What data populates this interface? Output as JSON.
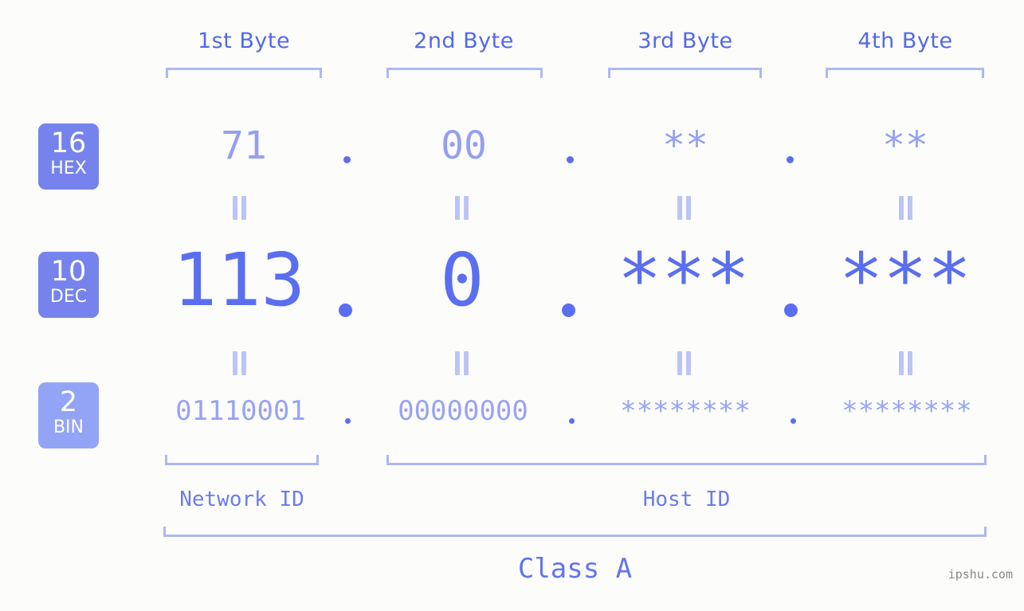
{
  "background_color": "#fcfdfa",
  "accent_color": "#5a6ef0",
  "accent_light_color": "#aeb7f2",
  "bytes": {
    "headers": [
      {
        "label": "1st Byte"
      },
      {
        "label": "2nd Byte"
      },
      {
        "label": "3rd Byte"
      },
      {
        "label": "4th Byte"
      }
    ]
  },
  "bases": [
    {
      "number": "16",
      "name": "HEX",
      "color": "#7683ec"
    },
    {
      "number": "10",
      "name": "DEC",
      "color": "#7683ec"
    },
    {
      "number": "2",
      "name": "BIN",
      "color": "#93a4f7"
    }
  ],
  "rows": {
    "hex": {
      "values": [
        "71",
        "00",
        "**",
        "**"
      ]
    },
    "dec": {
      "values": [
        "113",
        "0",
        "***",
        "***"
      ]
    },
    "bin": {
      "values": [
        "01110001",
        "00000000",
        "********",
        "********"
      ]
    }
  },
  "separators": {
    "glyph": ".",
    "equals_glyph": "="
  },
  "segments": [
    {
      "label": "Network ID"
    },
    {
      "label": "Host ID"
    }
  ],
  "class": {
    "label": "Class A"
  },
  "watermark": {
    "text": "ipshu.com"
  }
}
